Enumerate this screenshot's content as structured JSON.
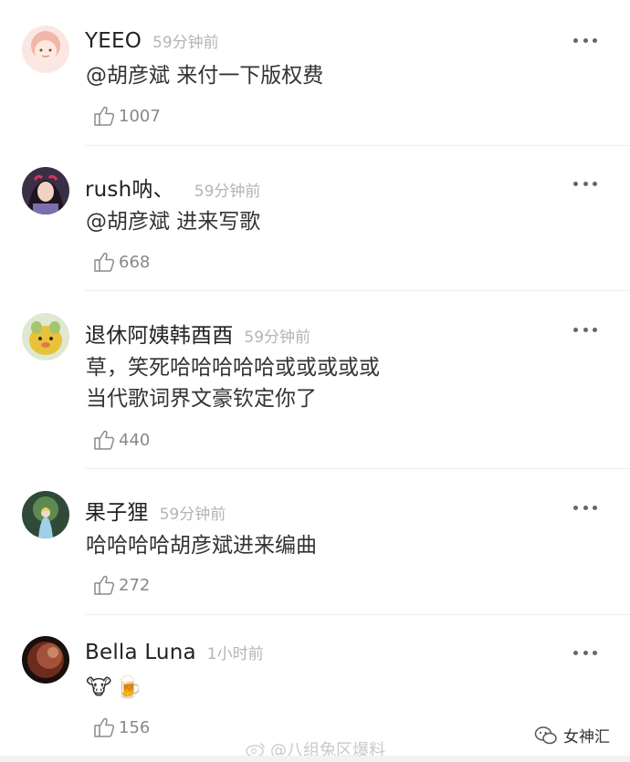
{
  "comments": [
    {
      "username": "YEEO",
      "time": "59分钟前",
      "lines": [
        "@胡彦斌 来付一下版权费"
      ],
      "likes": "1007"
    },
    {
      "username": "rush呐、",
      "time": "59分钟前",
      "lines": [
        "@胡彦斌 进来写歌"
      ],
      "likes": "668"
    },
    {
      "username": "退休阿姨韩酉酉",
      "time": "59分钟前",
      "lines": [
        "草，笑死哈哈哈哈哈或或或或或",
        "当代歌词界文豪钦定你了"
      ],
      "likes": "440"
    },
    {
      "username": "果子狸",
      "time": "59分钟前",
      "lines": [
        "哈哈哈哈胡彦斌进来编曲"
      ],
      "likes": "272"
    },
    {
      "username": "Bella Luna",
      "time": "1小时前",
      "emojis": [
        "🐮",
        "🍺"
      ],
      "likes": "156"
    }
  ],
  "watermark": "@八组兔区爆料",
  "brand": "女神汇",
  "icons": {
    "more": "more-dots-icon",
    "like": "thumbs-up-icon",
    "watermark": "weibo-logo-icon",
    "brand": "wechat-logo-icon"
  }
}
